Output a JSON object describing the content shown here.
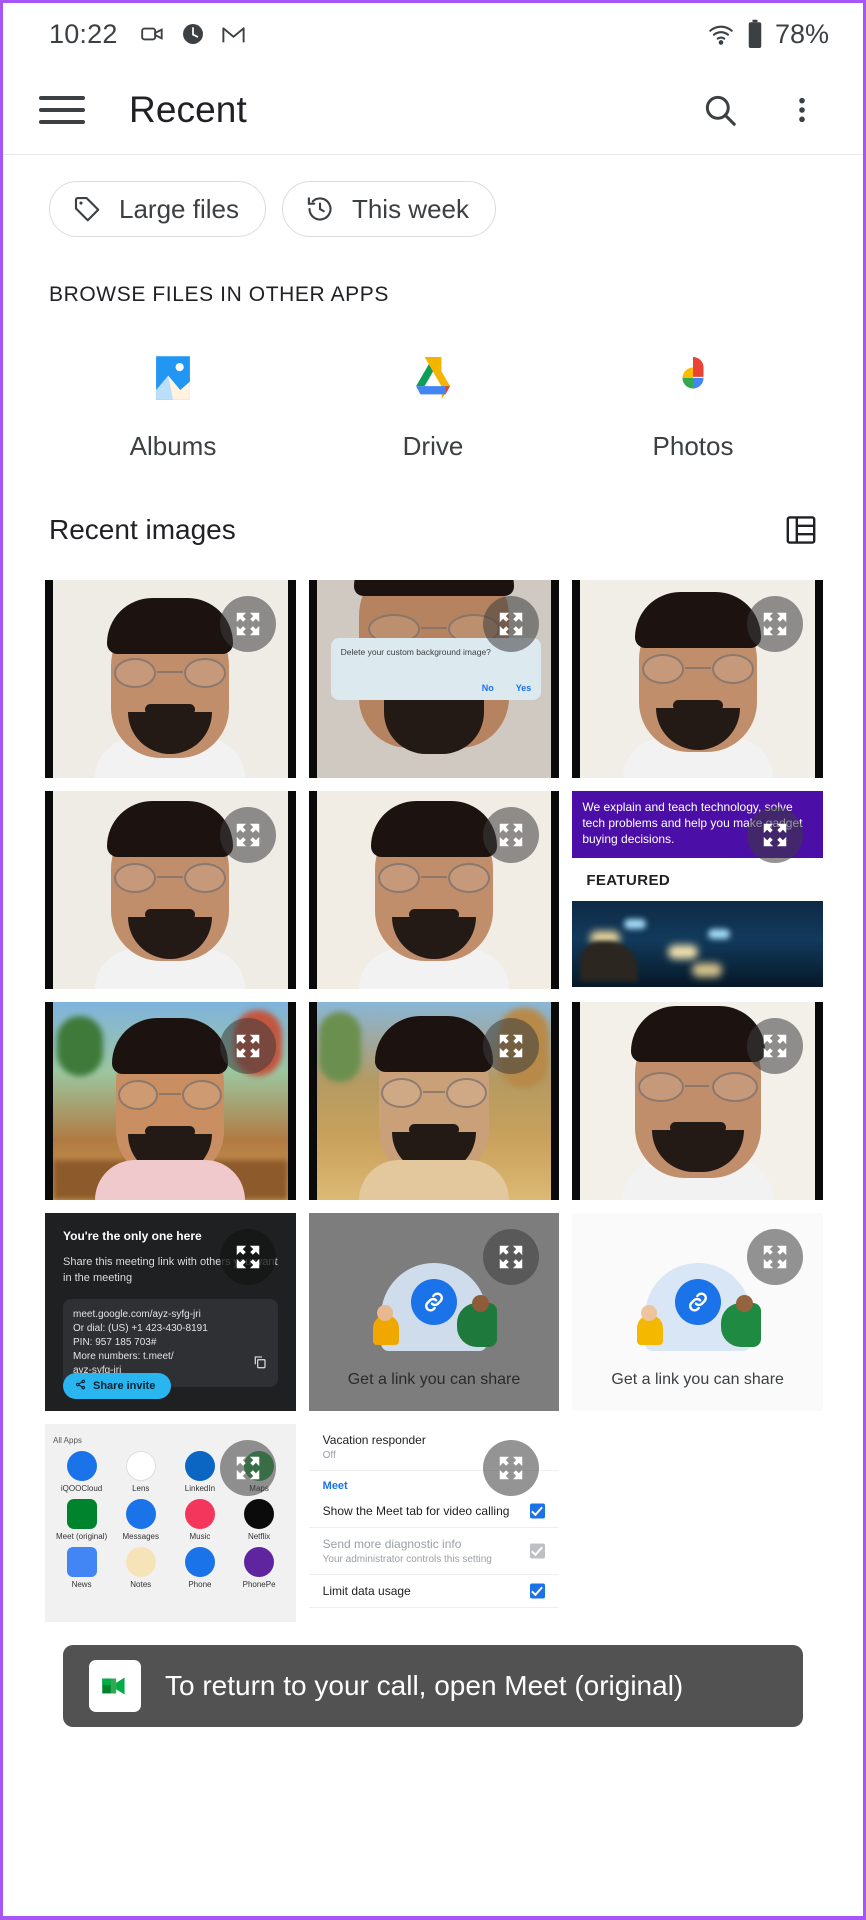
{
  "status_bar": {
    "time": "10:22",
    "battery_percent": "78%",
    "icons": [
      "video-camera-icon",
      "clock-icon",
      "gmail-icon",
      "wifi-icon",
      "battery-icon"
    ]
  },
  "app_bar": {
    "menu_icon": "hamburger-menu-icon",
    "title": "Recent",
    "search_icon": "search-icon",
    "overflow_icon": "more-vert-icon"
  },
  "chips": [
    {
      "label": "Large files",
      "icon": "tag-icon"
    },
    {
      "label": "This week",
      "icon": "history-clock-icon"
    }
  ],
  "browse_section": {
    "caption": "BROWSE FILES IN OTHER APPS",
    "apps": [
      {
        "label": "Albums",
        "icon": "albums-image-icon"
      },
      {
        "label": "Drive",
        "icon": "google-drive-icon"
      },
      {
        "label": "Photos",
        "icon": "google-photos-icon"
      }
    ]
  },
  "recent_images": {
    "title": "Recent images",
    "view_toggle_icon": "list-view-icon",
    "tiles": [
      {
        "id": 1,
        "type": "portrait",
        "bg": "#efece6",
        "expand_icon": "expand-icon"
      },
      {
        "id": 2,
        "type": "portrait-dialog",
        "bg": "#cfc9c2",
        "expand_icon": "expand-icon",
        "dialog": {
          "message": "Delete your custom background image?",
          "no": "No",
          "yes": "Yes"
        }
      },
      {
        "id": 3,
        "type": "portrait",
        "bg": "#f1eee8",
        "expand_icon": "expand-icon"
      },
      {
        "id": 4,
        "type": "portrait",
        "bg": "#efece6",
        "expand_icon": "expand-icon"
      },
      {
        "id": 5,
        "type": "portrait",
        "bg": "#f1ece4",
        "expand_icon": "expand-icon"
      },
      {
        "id": 6,
        "type": "featured",
        "expand_icon": "expand-icon",
        "banner_text": "We explain and teach technology, solve tech problems and help you make gadget buying decisions.",
        "label": "FEATURED"
      },
      {
        "id": 7,
        "type": "portrait-garden",
        "bg": "#b5713c",
        "expand_icon": "expand-icon"
      },
      {
        "id": 8,
        "type": "portrait-garden",
        "bg": "#c0884e",
        "expand_icon": "expand-icon"
      },
      {
        "id": 9,
        "type": "portrait",
        "bg": "#f3f0ea",
        "expand_icon": "expand-icon"
      },
      {
        "id": 10,
        "type": "meet-dark",
        "expand_icon": "expand-icon",
        "heading": "You're the only one here",
        "body": "Share this meeting link with others you want in the meeting",
        "link_lines": [
          "meet.google.com/ayz-syfg-jri",
          "Or dial: (US) +1 423-430-8191",
          "PIN: 957 185 703#",
          "More numbers: t.meet/",
          "ayz-syfg-jri"
        ],
        "copy_icon": "copy-icon",
        "share_button": "Share invite",
        "share_icon": "share-icon"
      },
      {
        "id": 11,
        "type": "link-share-gray",
        "expand_icon": "expand-icon",
        "caption": "Get a link you can share",
        "art_icon": "link-chain-icon"
      },
      {
        "id": 12,
        "type": "link-share-white",
        "expand_icon": "expand-icon",
        "caption": "Get a link you can share",
        "art_icon": "link-chain-icon"
      },
      {
        "id": 13,
        "type": "app-drawer",
        "expand_icon": "expand-icon",
        "header": "All Apps",
        "apps": [
          {
            "name": "iQOOCloud",
            "color": "#1a73e8"
          },
          {
            "name": "Lens",
            "color": "#ffffff"
          },
          {
            "name": "LinkedIn",
            "color": "#0a66c2"
          },
          {
            "name": "Maps",
            "color": "#34a853"
          },
          {
            "name": "Meet (original)",
            "color": "#00832d"
          },
          {
            "name": "Messages",
            "color": "#1a73e8"
          },
          {
            "name": "Music",
            "color": "#f5365c"
          },
          {
            "name": "Netflix",
            "color": "#0b0b0b"
          },
          {
            "name": "News",
            "color": "#4285f4"
          },
          {
            "name": "Notes",
            "color": "#f7e3b8"
          },
          {
            "name": "Phone",
            "color": "#1a73e8"
          },
          {
            "name": "PhonePe",
            "color": "#5f259f"
          }
        ]
      },
      {
        "id": 14,
        "type": "settings",
        "expand_icon": "expand-icon",
        "rows": [
          {
            "title": "Vacation responder",
            "sub": "Off",
            "checkbox": null
          },
          {
            "section": "Meet"
          },
          {
            "title": "Show the Meet tab for video calling",
            "sub": "",
            "checkbox": "checked"
          },
          {
            "title": "Send more diagnostic info",
            "sub": "Your administrator controls this setting",
            "checkbox": "disabled"
          },
          {
            "title": "Limit data usage",
            "sub": "",
            "checkbox": "checked"
          }
        ]
      },
      {
        "id": 15,
        "type": "blank-white",
        "expand_icon": null
      }
    ]
  },
  "toast": {
    "icon": "meet-app-icon",
    "message": "To return to your call, open Meet (original)"
  },
  "colors": {
    "accent_purple": "#a855f7",
    "google_blue": "#1a73e8",
    "google_green": "#34a853",
    "google_yellow": "#fbbc04",
    "google_red": "#ea4335",
    "meet_green": "#00832d",
    "text_primary": "#202124",
    "text_secondary": "#3c4043",
    "divider": "#dadce0"
  }
}
